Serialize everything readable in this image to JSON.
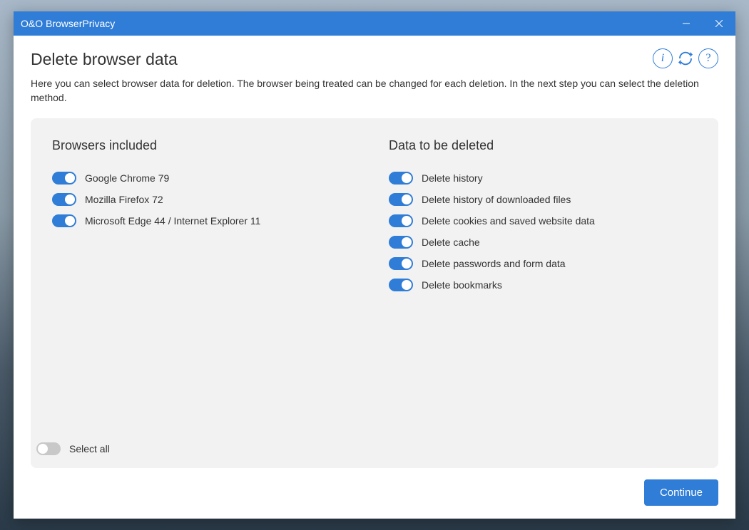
{
  "titlebar": {
    "title": "O&O BrowserPrivacy"
  },
  "page": {
    "title": "Delete browser data",
    "description": "Here you can select browser data for deletion. The browser being treated can be changed for each deletion. In the next step you can select the deletion method."
  },
  "panel": {
    "browsers": {
      "heading": "Browsers included",
      "items": [
        {
          "label": "Google Chrome 79",
          "on": true
        },
        {
          "label": "Mozilla Firefox 72",
          "on": true
        },
        {
          "label": "Microsoft Edge 44 / Internet Explorer 11",
          "on": true
        }
      ]
    },
    "data": {
      "heading": "Data to be deleted",
      "items": [
        {
          "label": "Delete history",
          "on": true
        },
        {
          "label": "Delete history of downloaded files",
          "on": true
        },
        {
          "label": "Delete cookies and saved website data",
          "on": true
        },
        {
          "label": "Delete cache",
          "on": true
        },
        {
          "label": "Delete passwords and form data",
          "on": true
        },
        {
          "label": "Delete bookmarks",
          "on": true
        }
      ]
    },
    "selectAll": {
      "label": "Select all",
      "on": false
    }
  },
  "footer": {
    "continueLabel": "Continue"
  }
}
